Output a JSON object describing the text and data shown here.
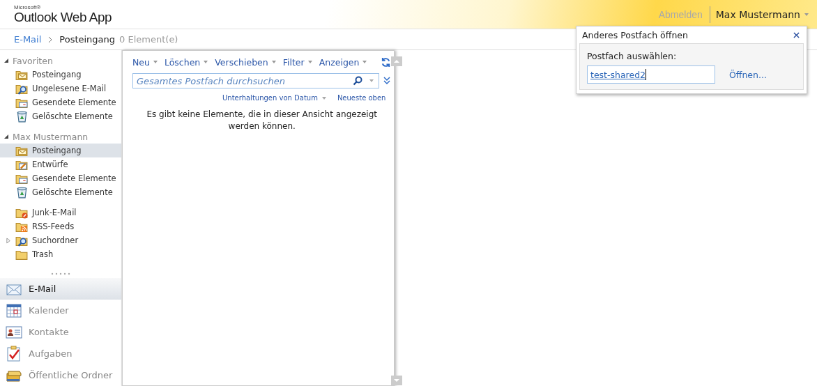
{
  "header": {
    "logo_small": "Microsoft®",
    "logo": "Outlook Web App",
    "signout": "Abmelden",
    "user": "Max Mustermann"
  },
  "breadcrumb": {
    "root": "E-Mail",
    "current": "Posteingang",
    "count": "0 Element(e)"
  },
  "sections": [
    {
      "title": "Favoriten",
      "expanded": true,
      "groups": [
        [
          {
            "label": "Posteingang",
            "kind": "inbox",
            "selected": false
          },
          {
            "label": "Ungelesene E-Mail",
            "kind": "searchfolder",
            "selected": false
          },
          {
            "label": "Gesendete Elemente",
            "kind": "sent",
            "selected": false
          },
          {
            "label": "Gelöschte Elemente",
            "kind": "deleted",
            "selected": false
          }
        ]
      ]
    },
    {
      "title": "Max Mustermann",
      "expanded": true,
      "groups": [
        [
          {
            "label": "Posteingang",
            "kind": "inbox",
            "selected": true
          },
          {
            "label": "Entwürfe",
            "kind": "drafts",
            "selected": false
          },
          {
            "label": "Gesendete Elemente",
            "kind": "sent",
            "selected": false
          },
          {
            "label": "Gelöschte Elemente",
            "kind": "deleted",
            "selected": false
          }
        ],
        [
          {
            "label": "Junk-E-Mail",
            "kind": "junk",
            "selected": false
          },
          {
            "label": "RSS-Feeds",
            "kind": "rss",
            "selected": false
          },
          {
            "label": "Suchordner",
            "kind": "searchfolder",
            "selected": false,
            "expanded": false
          },
          {
            "label": "Trash",
            "kind": "folder",
            "selected": false
          }
        ]
      ]
    }
  ],
  "modules": [
    {
      "label": "E-Mail",
      "kind": "mail",
      "selected": true
    },
    {
      "label": "Kalender",
      "kind": "calendar",
      "selected": false
    },
    {
      "label": "Kontakte",
      "kind": "contacts",
      "selected": false
    },
    {
      "label": "Aufgaben",
      "kind": "tasks",
      "selected": false
    },
    {
      "label": "Öffentliche Ordner",
      "kind": "public",
      "selected": false
    }
  ],
  "toolbar": [
    "Neu",
    "Löschen",
    "Verschieben",
    "Filter",
    "Anzeigen"
  ],
  "search": {
    "placeholder": "Gesamtes Postfach durchsuchen"
  },
  "sort": {
    "arrange": "Unterhaltungen von Datum",
    "order": "Neueste oben"
  },
  "empty_message": "Es gibt keine Elemente, die in dieser Ansicht angezeigt werden können.",
  "dialog": {
    "title": "Anderes Postfach öffnen",
    "label": "Postfach auswählen:",
    "value": "test-shared2",
    "open_link": "Öffnen..."
  }
}
